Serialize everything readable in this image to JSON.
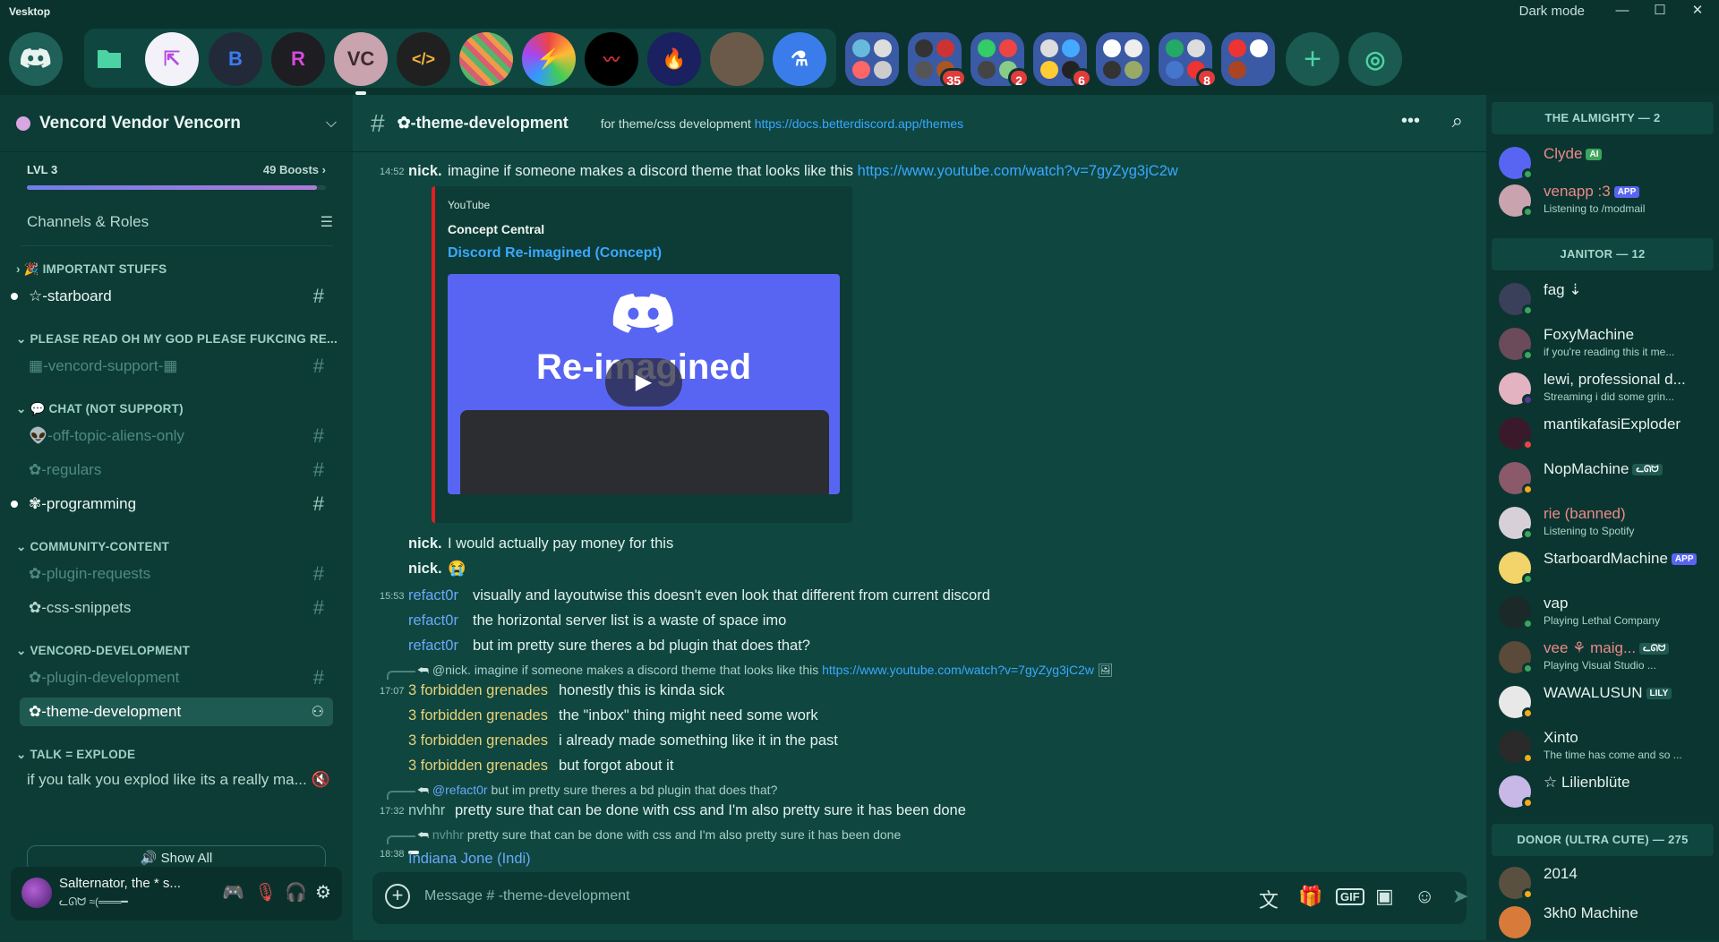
{
  "window": {
    "app_title": "Vesktop",
    "dark_mode_label": "Dark mode"
  },
  "servers": [
    {
      "name": "discord-home-icon",
      "color": "#1f6058"
    },
    {
      "name": "folder-icon",
      "color": "#0f4640"
    }
  ],
  "server_badges": [
    "35",
    "2",
    "6",
    "8"
  ],
  "sidebar": {
    "server_name": "Vencord Vendor Vencorn",
    "boost_level": "LVL 3",
    "boosts": "49 Boosts",
    "boost_progress": 0.97,
    "channels_roles": "Channels & Roles",
    "categories": {
      "important": "IMPORTANT STUFFS",
      "please": "PLEASE READ OH MY GOD PLEASE FUKCING RE...",
      "chat": "CHAT (NOT SUPPORT)",
      "community": "COMMUNITY-CONTENT",
      "dev": "VENCORD-DEVELOPMENT",
      "talk": "TALK = EXPLODE"
    },
    "channels": {
      "starboard": "-starboard",
      "support": "-vencord-support-",
      "offtopic": "-off-topic-aliens-only",
      "regulars": "-regulars",
      "programming": "-programming",
      "plugin_requests": "-plugin-requests",
      "css_snippets": "-css-snippets",
      "plugin_dev": "-plugin-development",
      "theme_dev": "-theme-development"
    },
    "talk_line": "if you talk you explod like its a really ma...",
    "show_all": "Show All",
    "user": {
      "name": "Salternator, the * s...",
      "status": "ᓚᘏᗢ ≈(═══━"
    }
  },
  "chat": {
    "channel_name": "-theme-development",
    "topic": "for theme/css development",
    "topic_link": "https://docs.betterdiscord.app/themes",
    "composer_placeholder": "Message # -theme-development",
    "embed": {
      "provider": "YouTube",
      "author": "Concept Central",
      "title": "Discord Re-imagined (Concept)",
      "thumb_text": "Re-imagined"
    },
    "messages": {
      "m1": {
        "time": "14:52",
        "author": "nick.",
        "text": "imagine if someone makes a discord theme that looks like this",
        "link": "https://www.youtube.com/watch?v=7gyZyg3jC2w"
      },
      "m2": {
        "author": "nick.",
        "text": "I would actually pay money for this"
      },
      "m3": {
        "author": "nick.",
        "text": "😭"
      },
      "m4": {
        "time": "15:53",
        "author": "refact0r",
        "text": "visually and layoutwise this doesn't even look that different from current discord"
      },
      "m5": {
        "author": "refact0r",
        "text": "the horizontal server list is a waste of space imo"
      },
      "m6": {
        "author": "refact0r",
        "text": "but im pretty sure theres a bd plugin that does that?"
      },
      "r1": {
        "author": "@nick.",
        "text": "imagine if someone makes a discord theme that looks like this",
        "link": "https://www.youtube.com/watch?v=7gyZyg3jC2w"
      },
      "m7": {
        "time": "17:07",
        "author": "3 forbidden grenades",
        "text": "honestly this is kinda sick"
      },
      "m8": {
        "author": "3 forbidden grenades",
        "text": "the \"inbox\" thing might need some work"
      },
      "m9": {
        "author": "3 forbidden grenades",
        "text": "i already made something like it in the past"
      },
      "m10": {
        "author": "3 forbidden grenades",
        "text": "but forgot about it"
      },
      "r2": {
        "author": "@refact0r",
        "text": "but im pretty sure theres a bd plugin that does that?"
      },
      "m11": {
        "time": "17:32",
        "author": "nvhhr",
        "text": "pretty sure that can be done with css and I'm also pretty sure it has been done"
      },
      "r3": {
        "author": "nvhhr",
        "text": "pretty sure that can be done with css and I'm also pretty sure it has been done"
      },
      "m12": {
        "time": "18:38",
        "author": "Indiana Jone (Indi)"
      }
    }
  },
  "members": {
    "roles": {
      "almighty": "THE ALMIGHTY — 2",
      "janitor": "JANITOR — 12",
      "donor": "DONOR (ULTRA CUTE) — 275"
    },
    "list": {
      "clyde": {
        "name": "Clyde",
        "tag": "AI"
      },
      "venapp": {
        "name": "venapp :3",
        "tag": "APP",
        "sub": "Listening to /modmail"
      },
      "fag": {
        "name": "fag ⇣"
      },
      "foxy": {
        "name": "FoxyMachine",
        "sub": "if you're reading this it me..."
      },
      "lewi": {
        "name": "lewi, professional d...",
        "sub": "Streaming i did some grin..."
      },
      "mantika": {
        "name": "mantikafasiExploder"
      },
      "nop": {
        "name": "NopMachine",
        "tag": "ᓚᘏᗢ"
      },
      "rie": {
        "name": "rie (banned)",
        "sub": "Listening to Spotify"
      },
      "starboard": {
        "name": "StarboardMachine",
        "tag": "APP"
      },
      "vap": {
        "name": "vap",
        "sub": "Playing Lethal Company"
      },
      "vee": {
        "name": "vee ⚘ maig...",
        "tag": "ᓚᘏᗢ",
        "sub": "Playing Visual Studio ..."
      },
      "wawa": {
        "name": "WAWALUSUN",
        "tag": "LILY"
      },
      "xinto": {
        "name": "Xinto",
        "sub": "The time has come and so ..."
      },
      "lilien": {
        "name": "☆ Lilienblüte"
      },
      "y2014": {
        "name": "2014"
      },
      "khomachine": {
        "name": "3kh0 Machine"
      }
    }
  }
}
